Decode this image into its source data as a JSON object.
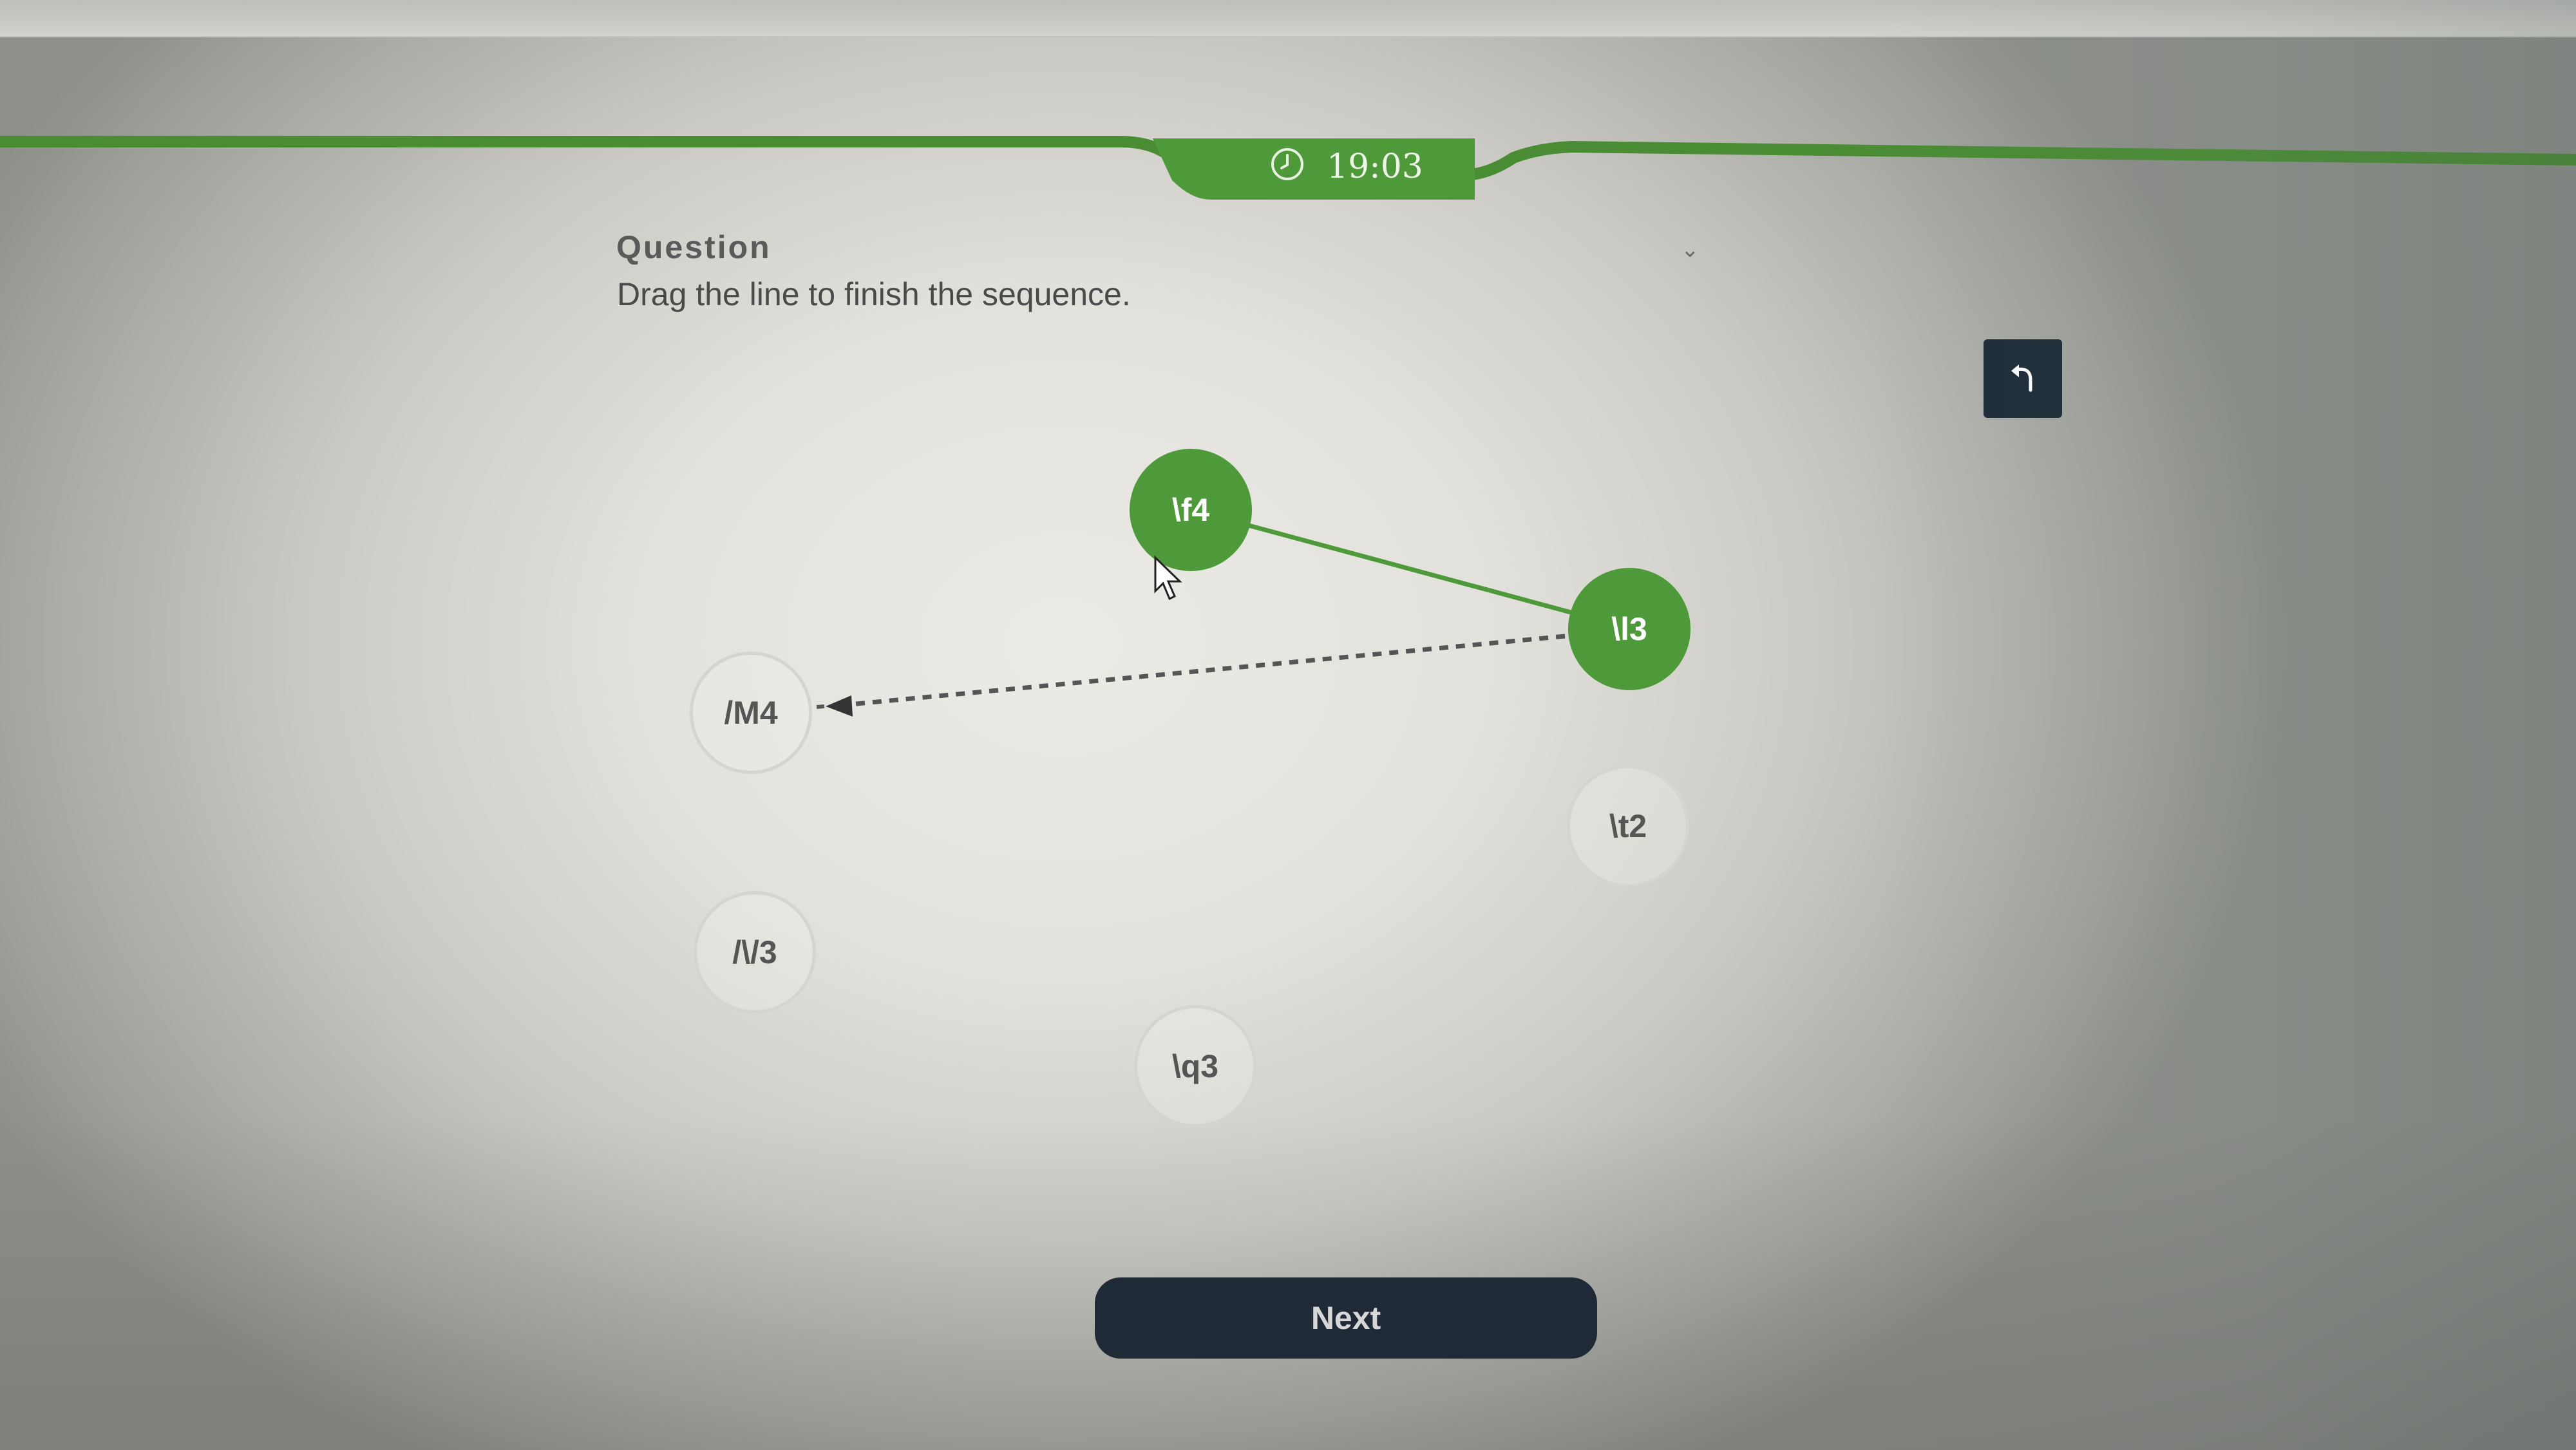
{
  "timer": {
    "time": "19:03",
    "icon": "clock-icon"
  },
  "question": {
    "heading": "Question",
    "text": "Drag the line to finish the sequence."
  },
  "toolbar": {
    "undo_icon": "undo-icon"
  },
  "nodes": [
    {
      "label": "\\f4",
      "state": "connected"
    },
    {
      "label": "\\l3",
      "state": "connected"
    },
    {
      "label": "/M4",
      "state": "available"
    },
    {
      "label": "\\t2",
      "state": "available"
    },
    {
      "label": "/\\/3",
      "state": "available"
    },
    {
      "label": "\\q3",
      "state": "available"
    }
  ],
  "connections": [
    {
      "from": "\\f4",
      "to": "\\l3",
      "style": "solid"
    },
    {
      "from": "\\l3",
      "to": "/M4",
      "style": "dragging"
    }
  ],
  "next_button": {
    "label": "Next"
  },
  "colors": {
    "accent_green": "#4e9a3a",
    "dark_navy": "#1f2a38"
  }
}
